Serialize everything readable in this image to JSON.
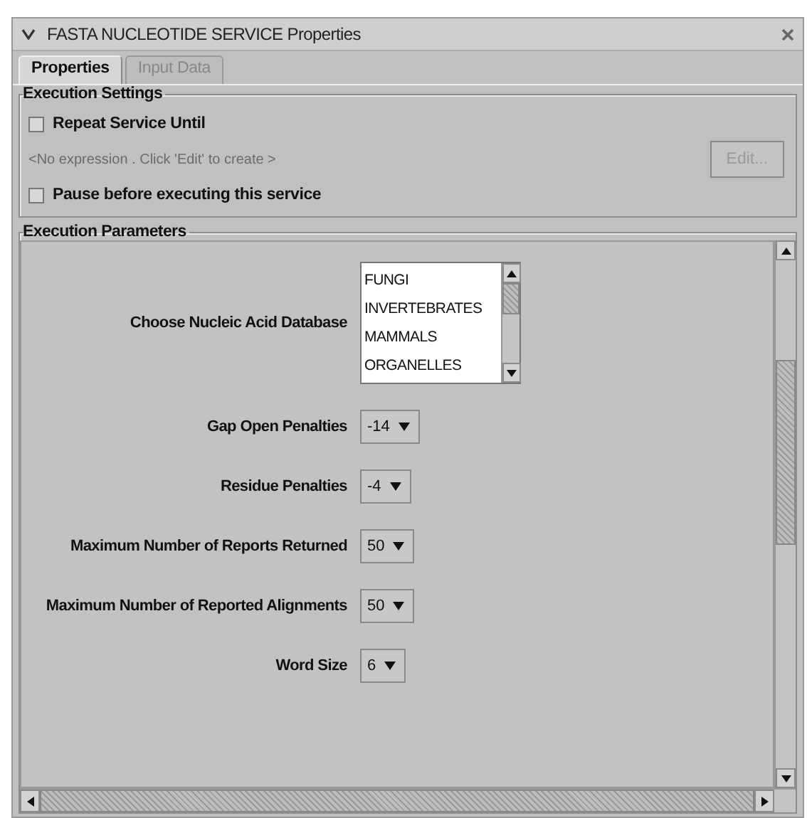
{
  "window": {
    "title": "FASTA NUCLEOTIDE SERVICE Properties"
  },
  "tabs": [
    {
      "label": "Properties",
      "selected": true
    },
    {
      "label": "Input Data",
      "selected": false
    }
  ],
  "execution_settings": {
    "title": "Execution Settings",
    "repeat": {
      "label": "Repeat Service Until",
      "checked": false
    },
    "expression": {
      "text": "<No expression . Click 'Edit' to create >",
      "disabled": true
    },
    "edit_button": {
      "label": "Edit...",
      "disabled": true
    },
    "pause": {
      "label": "Pause before executing this service",
      "checked": false
    }
  },
  "execution_parameters": {
    "title": "Execution Parameters",
    "fields": [
      {
        "kind": "list",
        "label": "Choose Nucleic Acid Database",
        "items": [
          "FUNGI",
          "INVERTEBRATES",
          "MAMMALS",
          "ORGANELLES"
        ]
      },
      {
        "kind": "dropdown",
        "label": "Gap Open Penalties",
        "value": "-14"
      },
      {
        "kind": "dropdown",
        "label": "Residue Penalties",
        "value": "-4"
      },
      {
        "kind": "dropdown",
        "label": "Maximum Number of Reports Returned",
        "value": "50"
      },
      {
        "kind": "dropdown",
        "label": "Maximum Number of Reported Alignments",
        "value": "50"
      },
      {
        "kind": "dropdown",
        "label": "Word Size",
        "value": "6"
      }
    ]
  }
}
